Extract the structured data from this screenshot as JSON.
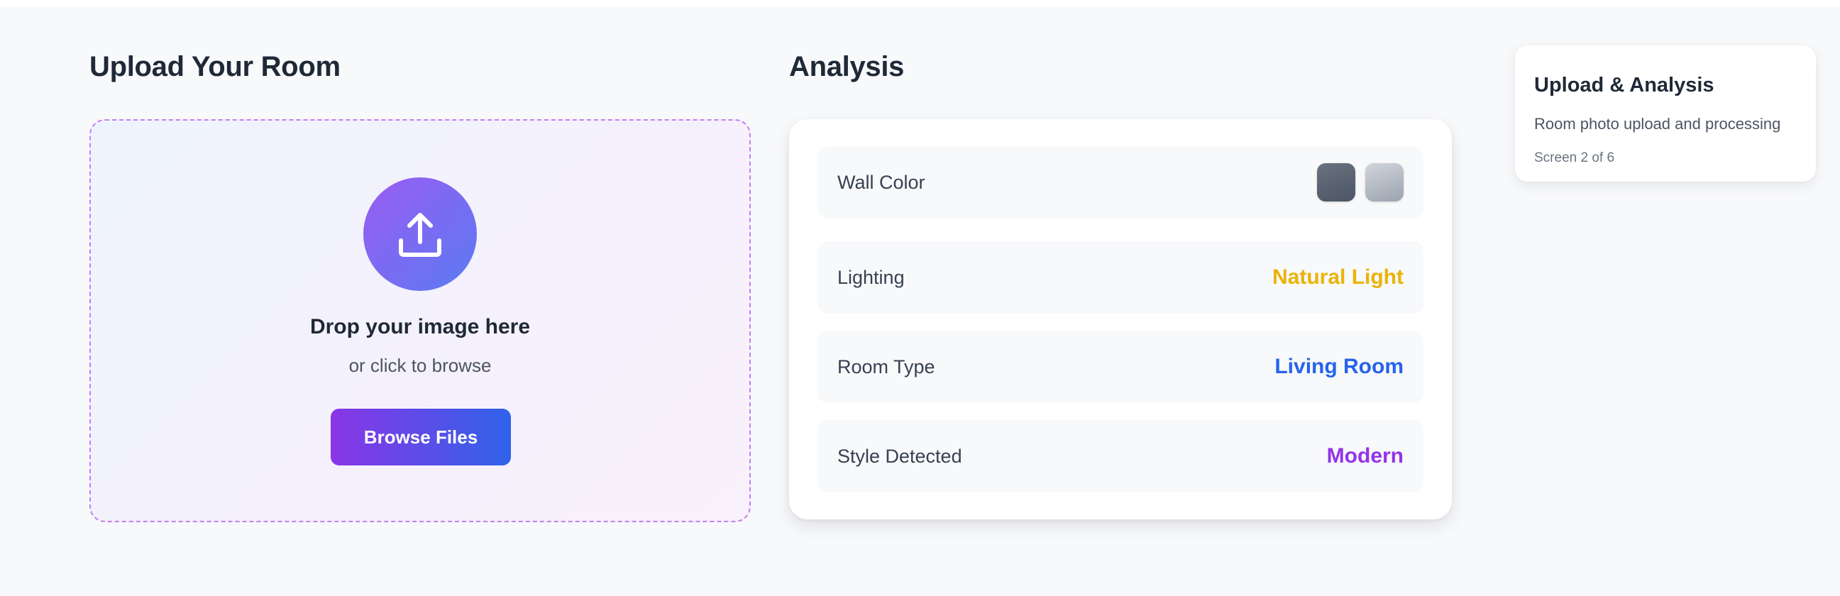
{
  "upload": {
    "title": "Upload Your Room",
    "drop_heading": "Drop your image here",
    "drop_subtext": "or click to browse",
    "browse_label": "Browse Files",
    "icon": "upload-icon"
  },
  "analysis": {
    "title": "Analysis",
    "wall_color": {
      "label": "Wall Color",
      "swatches": [
        "#6b7280",
        "#9ca3af"
      ]
    },
    "lighting": {
      "label": "Lighting",
      "value": "Natural Light",
      "color": "#eab308"
    },
    "room_type": {
      "label": "Room Type",
      "value": "Living Room",
      "color": "#2563eb"
    },
    "style": {
      "label": "Style Detected",
      "value": "Modern",
      "color": "#9333ea"
    }
  },
  "info_card": {
    "title": "Upload & Analysis",
    "description": "Room photo upload and processing",
    "step": "Screen 2 of 6"
  },
  "colors": {
    "accent_purple": "#8a35e6",
    "accent_blue": "#2f63ea",
    "dropzone_border": "#c47ef0",
    "page_background": "#f8f9fb"
  }
}
